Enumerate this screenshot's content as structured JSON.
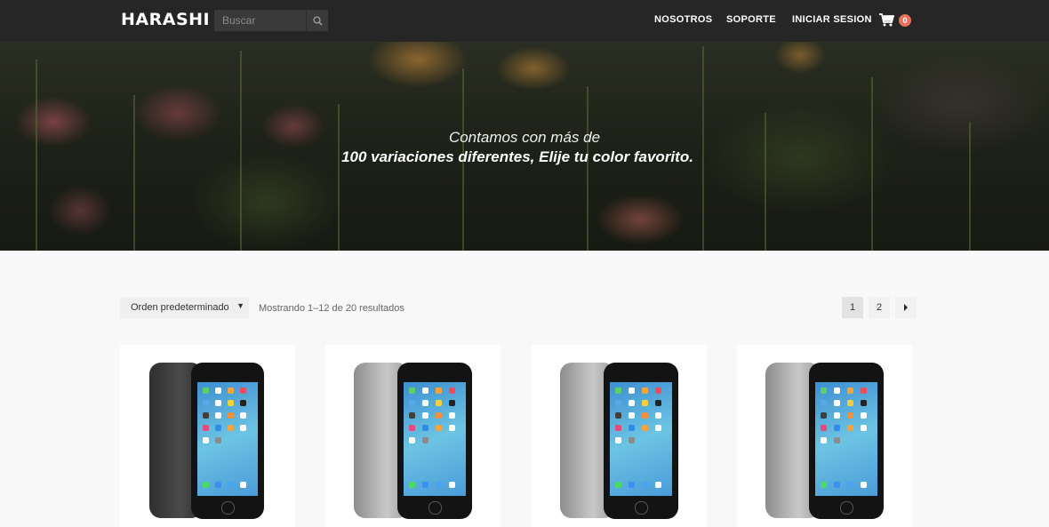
{
  "header": {
    "logo": "HARASHI",
    "search_placeholder": "Buscar",
    "nav": [
      "NOSOTROS",
      "SOPORTE",
      "INICIAR SESION"
    ],
    "cart_count": "0",
    "accent_color": "#e9725a"
  },
  "hero": {
    "line1": "Contamos con más de",
    "line2": "100 variaciones diferentes, Elije tu color favorito."
  },
  "toolbar": {
    "sort_selected": "Orden predeterminado",
    "result_count": "Mostrando 1–12 de 20 resultados",
    "pages": [
      "1",
      "2"
    ],
    "current_page": "1",
    "next_icon": "chevron-right-icon"
  },
  "products": [
    {
      "color": "space-gray"
    },
    {
      "color": "silver-gray"
    },
    {
      "color": "silver-gray"
    },
    {
      "color": "silver-gray"
    }
  ]
}
